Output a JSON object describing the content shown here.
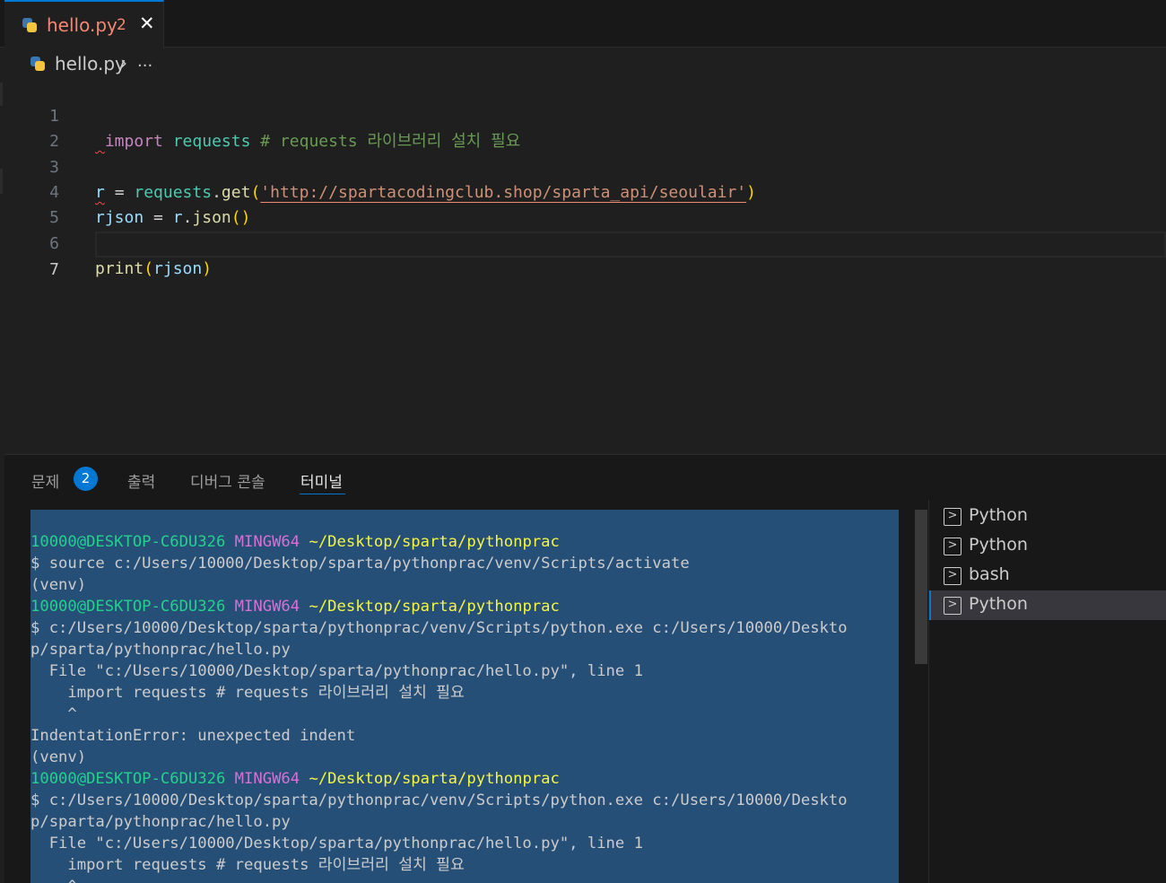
{
  "tab": {
    "title": "hello.py",
    "problem_count": "2",
    "close_glyph": "✕",
    "icon": "python-file-icon"
  },
  "breadcrumb": {
    "file": "hello.py",
    "separator": "›",
    "more": "..."
  },
  "editor": {
    "line_numbers": [
      "1",
      "2",
      "3",
      "4",
      "5",
      "6",
      "7"
    ],
    "line1": {
      "kw": "import",
      "mod": "requests",
      "comment": "# requests 라이브러리 설치 필요"
    },
    "line3": {
      "var": "r",
      "eq": "=",
      "obj": "requests",
      "dot": ".",
      "fn": "get",
      "open": "(",
      "str": "'http://spartacodingclub.shop/sparta_api/seoulair'",
      "close": ")"
    },
    "line4": {
      "var": "rjson",
      "eq": "=",
      "obj": "r",
      "dot": ".",
      "fn": "json",
      "parens": "()"
    },
    "line6": {
      "fn": "print",
      "open": "(",
      "arg": "rjson",
      "close": ")"
    }
  },
  "panel": {
    "tabs": {
      "problems": "문제",
      "output": "출력",
      "debug_console": "디버그 콘솔",
      "terminal": "터미널"
    },
    "problems_badge": "2"
  },
  "terminal": {
    "prompt_user": "10000@DESKTOP-C6DU326",
    "prompt_host": "MINGW64",
    "prompt_path": "~/Desktop/sparta/pythonprac",
    "cmd_activate": "$ source c:/Users/10000/Desktop/sparta/pythonprac/venv/Scripts/activate",
    "venv": "(venv)",
    "cmd_run_1": "$ c:/Users/10000/Desktop/sparta/pythonprac/venv/Scripts/python.exe c:/Users/10000/Deskto",
    "cmd_run_2": "p/sparta/pythonprac/hello.py",
    "err_file": "  File \"c:/Users/10000/Desktop/sparta/pythonprac/hello.py\", line 1",
    "err_code": "    import requests # requests 라이브러리 설치 필요",
    "err_caret": "    ^",
    "err_msg": "IndentationError: unexpected indent"
  },
  "terminal_list": [
    {
      "label": "Python",
      "icon": "terminal-icon"
    },
    {
      "label": "Python",
      "icon": "terminal-icon"
    },
    {
      "label": "bash",
      "icon": "terminal-icon"
    },
    {
      "label": "Python",
      "icon": "terminal-icon",
      "active": true
    }
  ],
  "colors": {
    "accent": "#0078d4",
    "error": "#f48771",
    "selection": "#264f78"
  }
}
